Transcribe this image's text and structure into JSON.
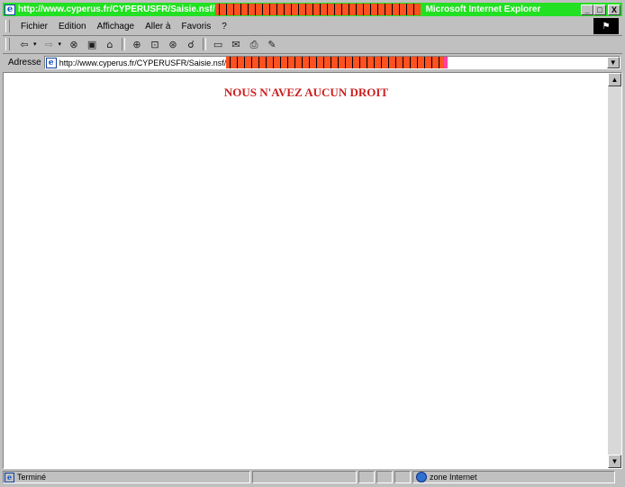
{
  "window": {
    "title_url": "http://www.cyperus.fr/CYPERUSFR/Saisie.nsf/",
    "app_name": "Microsoft Internet Explorer",
    "minimize": "_",
    "maximize": "□",
    "close": "X"
  },
  "menu": {
    "items": [
      "Fichier",
      "Edition",
      "Affichage",
      "Aller à",
      "Favoris",
      "?"
    ]
  },
  "toolbar": {
    "icons": [
      "back-icon",
      "forward-icon",
      "stop-icon",
      "refresh-icon",
      "home-icon",
      "search-icon",
      "favorites-icon",
      "history-icon",
      "channels-icon",
      "fullscreen-icon",
      "mail-icon",
      "print-icon",
      "edit-icon"
    ]
  },
  "address": {
    "label": "Adresse",
    "url": "http://www.cyperus.fr/CYPERUSFR/Saisie.nsf/"
  },
  "content": {
    "heading": "NOUS N'AVEZ AUCUN DROIT"
  },
  "status": {
    "text": "Terminé",
    "zone": "zone Internet"
  },
  "colors": {
    "titlebar": "#22e022",
    "heading": "#cc2020",
    "garble": "#ff5020"
  }
}
